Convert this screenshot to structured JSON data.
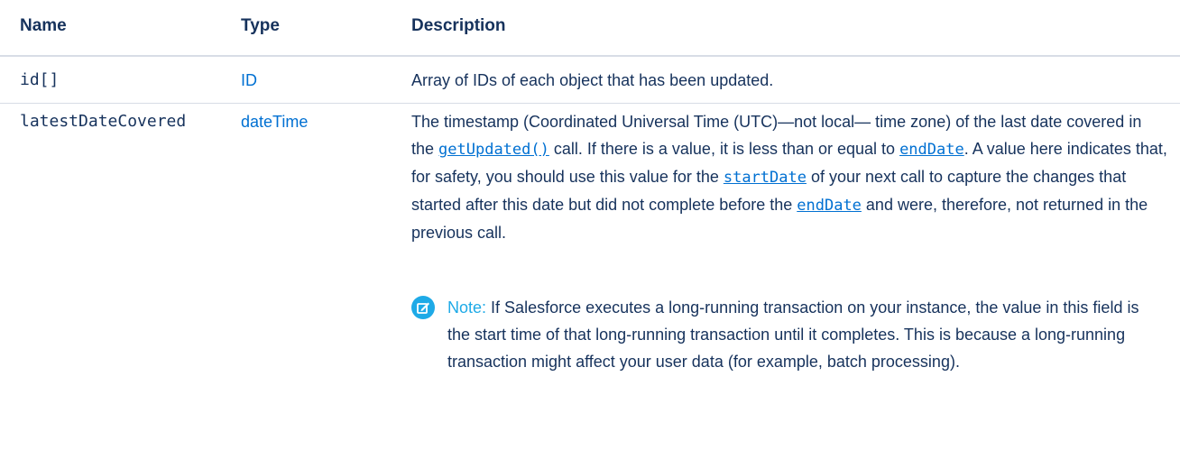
{
  "headers": {
    "name": "Name",
    "type": "Type",
    "description": "Description"
  },
  "rows": [
    {
      "name": "id[]",
      "type": "ID",
      "description": "Array of IDs of each object that has been updated."
    },
    {
      "name": "latestDateCovered",
      "type": "dateTime",
      "description_parts": {
        "p1": "The timestamp (Coordinated Universal Time (UTC)—not local— time zone) of the last date covered in the ",
        "link1": "getUpdated()",
        "p2": " call. If there is a value, it is less than or equal to ",
        "link2": "endDate",
        "p3": ". A value here indicates that, for safety, you should use this value for the ",
        "link3": "startDate",
        "p4": " of your next call to capture the changes that started after this date but did not complete before the ",
        "link4": "endDate",
        "p5": " and were, therefore, not returned in the previous call."
      },
      "note": {
        "label": "Note:",
        "text": "If Salesforce executes a long-running transaction on your instance, the value in this field is the start time of that long-running transaction until it completes. This is because a long-running transaction might affect your user data (for example, batch processing)."
      }
    }
  ],
  "colors": {
    "link": "#0070d2",
    "note_accent": "#1eaae7",
    "text": "#16325c",
    "divider": "#d8dde6"
  },
  "icons": {
    "note": "edit-note-icon"
  }
}
